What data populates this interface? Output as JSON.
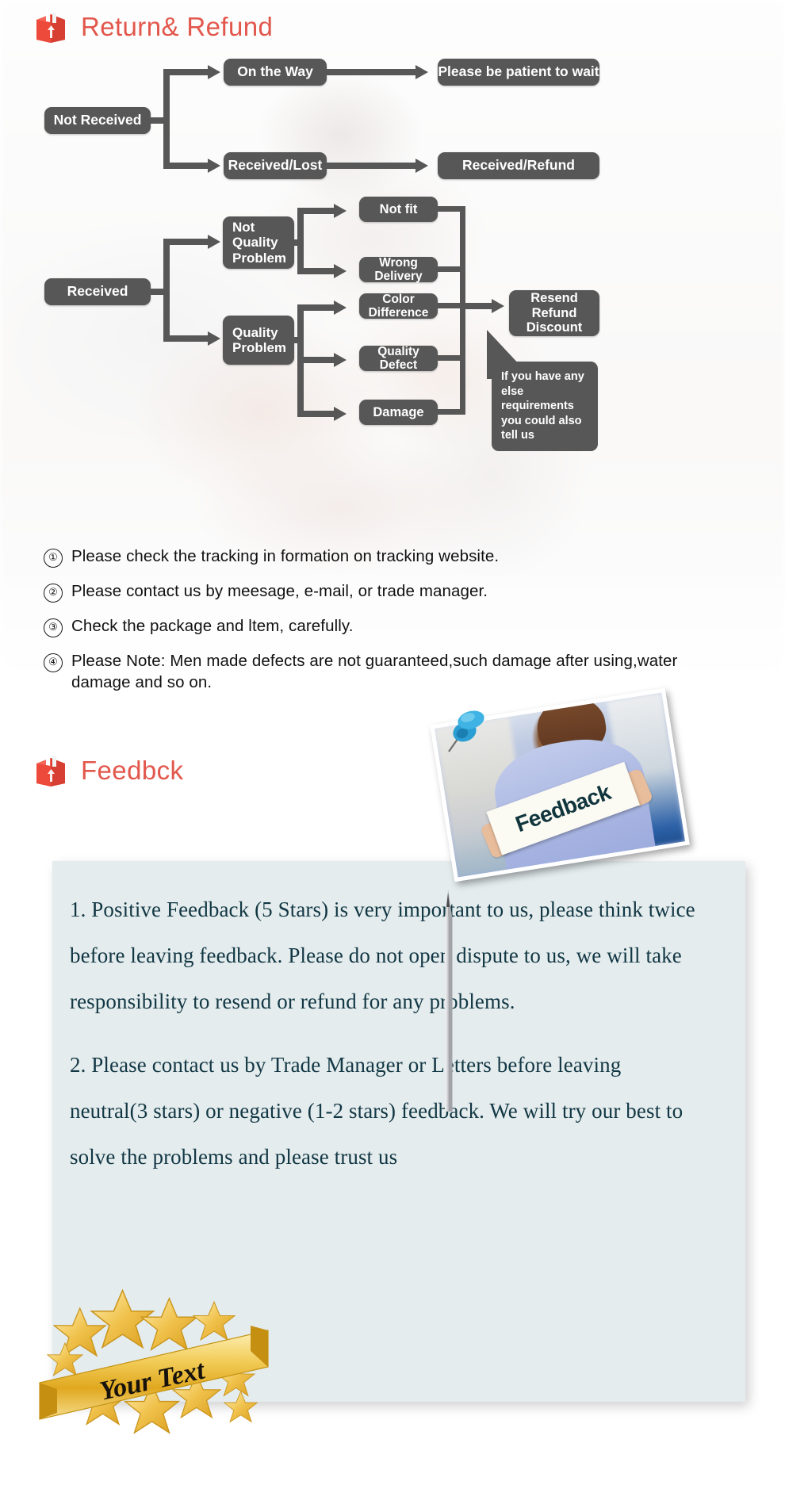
{
  "sections": {
    "return_refund": {
      "title": "Return& Refund",
      "icon": "box-icon",
      "accent_color": "#e2574c"
    },
    "feedback": {
      "title": "Feedbck",
      "icon": "box-icon",
      "accent_color": "#e2574c"
    }
  },
  "flowchart": {
    "nodes": {
      "not_received": "Not Received",
      "on_the_way": "On the Way",
      "please_wait": "Please be patient to wait",
      "received_lost": "Received/Lost",
      "received_refund": "Received/Refund",
      "received": "Received",
      "not_quality_problem": "Not\nQuality\nProblem",
      "not_quality_problem_l1": "Not",
      "not_quality_problem_l2": "Quality",
      "not_quality_problem_l3": "Problem",
      "quality_problem_l1": "Quality",
      "quality_problem_l2": "Problem",
      "not_fit": "Not fit",
      "wrong_delivery": "Wrong Delivery",
      "color_difference": "Color Difference",
      "quality_defect": "Quality Defect",
      "damage": "Damage",
      "resend_l1": "Resend",
      "resend_l2": "Refund",
      "resend_l3": "Discount"
    },
    "callout": "If you have any else requirements you could also tell us",
    "node_color": "#575757",
    "node_text_color": "#ffffff"
  },
  "notes": [
    {
      "num": "①",
      "text": "Please check the tracking in formation on tracking website."
    },
    {
      "num": "②",
      "text": "Please contact us by meesage, e-mail, or trade manager."
    },
    {
      "num": "③",
      "text": "Check the package and ltem, carefully."
    },
    {
      "num": "④",
      "text": "Please Note: Men made defects  are not guaranteed,such damage after using,water damage and so on."
    }
  ],
  "feedback_photo": {
    "sign_text": "Feedback",
    "pin_color": "#2b9fd4"
  },
  "feedback_panel": {
    "background_color": "#e4eced",
    "text_color": "#123744",
    "paragraphs": [
      "1. Positive Feedback (5 Stars) is very important to us, please think twice before leaving feedback. Please do not open dispute to us,   we will take responsibility to resend or refund for any problems.",
      "2. Please contact us by Trade Manager or Letters before leaving neutral(3 stars) or negative (1-2 stars) feedback. We will try our best to solve the problems and please trust us"
    ]
  },
  "badge": {
    "ribbon_text": "Your Text",
    "ribbon_color": "#e8b421"
  }
}
